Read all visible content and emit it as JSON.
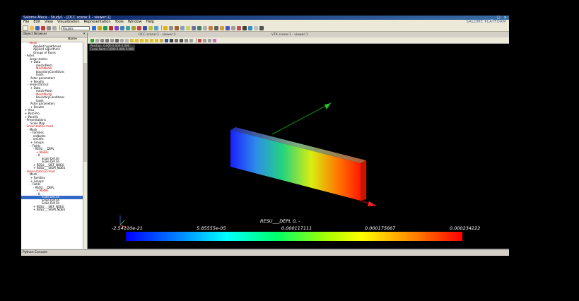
{
  "window": {
    "title": "Salome-Meca - Study1 - [OCC scene:1 - viewer:1]",
    "controls": "_ □ x"
  },
  "menu": [
    "File",
    "Edit",
    "View",
    "Visualization",
    "Representation",
    "Tools",
    "Window",
    "Help"
  ],
  "brand": "SALOME PLATFORM",
  "toolbar": {
    "module_combo": "ParaVis"
  },
  "object_browser": {
    "title": "Object Browser",
    "column": "Name",
    "rows": [
      {
        "text": "- Mesh",
        "red": true,
        "indent": 2
      },
      {
        "text": "Applied hypotheses",
        "indent": 4
      },
      {
        "text": "Applied algorithms",
        "indent": 4
      },
      {
        "text": "Groups of Faces",
        "indent": 4
      },
      {
        "text": "- Aster",
        "indent": 1
      },
      {
        "text": "- linear-statics",
        "indent": 2
      },
      {
        "text": "+ Data",
        "indent": 3
      },
      {
        "text": "mesh-Mesh",
        "indent": 5
      },
      {
        "text": "MeshModel",
        "red": true,
        "indent": 5
      },
      {
        "text": "boundaryConditions",
        "indent": 5
      },
      {
        "text": "loads",
        "indent": 5
      },
      {
        "text": "Aster parameters",
        "indent": 3
      },
      {
        "text": "+ Results",
        "indent": 3
      },
      {
        "text": "- linearstatics2",
        "indent": 2
      },
      {
        "text": "+ Data",
        "indent": 3
      },
      {
        "text": "mesh-Mesh",
        "indent": 5
      },
      {
        "text": "MeshModel",
        "red": true,
        "indent": 5
      },
      {
        "text": "boundaryConditions",
        "indent": 5
      },
      {
        "text": "loads",
        "indent": 5
      },
      {
        "text": "Aster parameters",
        "indent": 3
      },
      {
        "text": "+ Results",
        "indent": 3
      },
      {
        "text": "+ Visu",
        "indent": 1
      },
      {
        "text": "+ Post-Pro",
        "indent": 1
      },
      {
        "text": "+ ParaVis",
        "indent": 1
      },
      {
        "text": "- Presentations",
        "indent": 1
      },
      {
        "text": "Scale Map",
        "indent": 3
      },
      {
        "text": "- linear-statics.rmed",
        "red": true,
        "indent": 1
      },
      {
        "text": "- Mesh",
        "indent": 2
      },
      {
        "text": "- Families",
        "indent": 3
      },
      {
        "text": "onNodes",
        "indent": 4
      },
      {
        "text": "onCells",
        "indent": 4
      },
      {
        "text": "+ Groups",
        "indent": 3
      },
      {
        "text": "- Fields",
        "indent": 3
      },
      {
        "text": "- RESU___DEPL",
        "indent": 4
      },
      {
        "text": "+ Modes",
        "red": true,
        "indent": 5
      },
      {
        "text": "- 0, -",
        "indent": 5
      },
      {
        "text": "Scale Def.Sh",
        "indent": 7
      },
      {
        "text": "Scale Def.Sh",
        "indent": 7
      },
      {
        "text": "+ RESU___SIEF_NOEU",
        "indent": 4
      },
      {
        "text": "+ RESU___SIGM_NOEU",
        "indent": 4
      },
      {
        "text": "- linear-statics2.rmed",
        "red": true,
        "indent": 1
      },
      {
        "text": "- Mesh",
        "indent": 2
      },
      {
        "text": "+ Families",
        "indent": 3
      },
      {
        "text": "+ Groups",
        "indent": 3
      },
      {
        "text": "- Fields",
        "indent": 3
      },
      {
        "text": "- RESU___DEPL",
        "indent": 4
      },
      {
        "text": "+ Modes",
        "red": true,
        "indent": 5
      },
      {
        "text": "- 0, -",
        "indent": 5
      },
      {
        "text": "Scale Def.Sh",
        "indent": 7,
        "selected": true
      },
      {
        "text": "Scale Def.Sh",
        "indent": 7
      },
      {
        "text": "Scale Def.Sh",
        "indent": 7
      },
      {
        "text": "+ RESU___SIEF_NOEU",
        "indent": 4
      },
      {
        "text": "+ RESU___SIGM_NOEU",
        "indent": 4
      }
    ]
  },
  "viewer": {
    "tabs": [
      "OCC scene:1 - viewer:1",
      "VTK scene:1 - viewer:1"
    ],
    "info_lines": [
      "Position: 0.000 0.000 0.000",
      "Focal Point: 0.000 0.000 0.000"
    ],
    "colorbar_title": "RESU___DEPL 0, -",
    "tick_labels": [
      "-2.54110e-21",
      "5.85555e-05",
      "0.000117111",
      "0.000175667",
      "0.000234222"
    ]
  },
  "python_console": {
    "title": "Python Console"
  }
}
